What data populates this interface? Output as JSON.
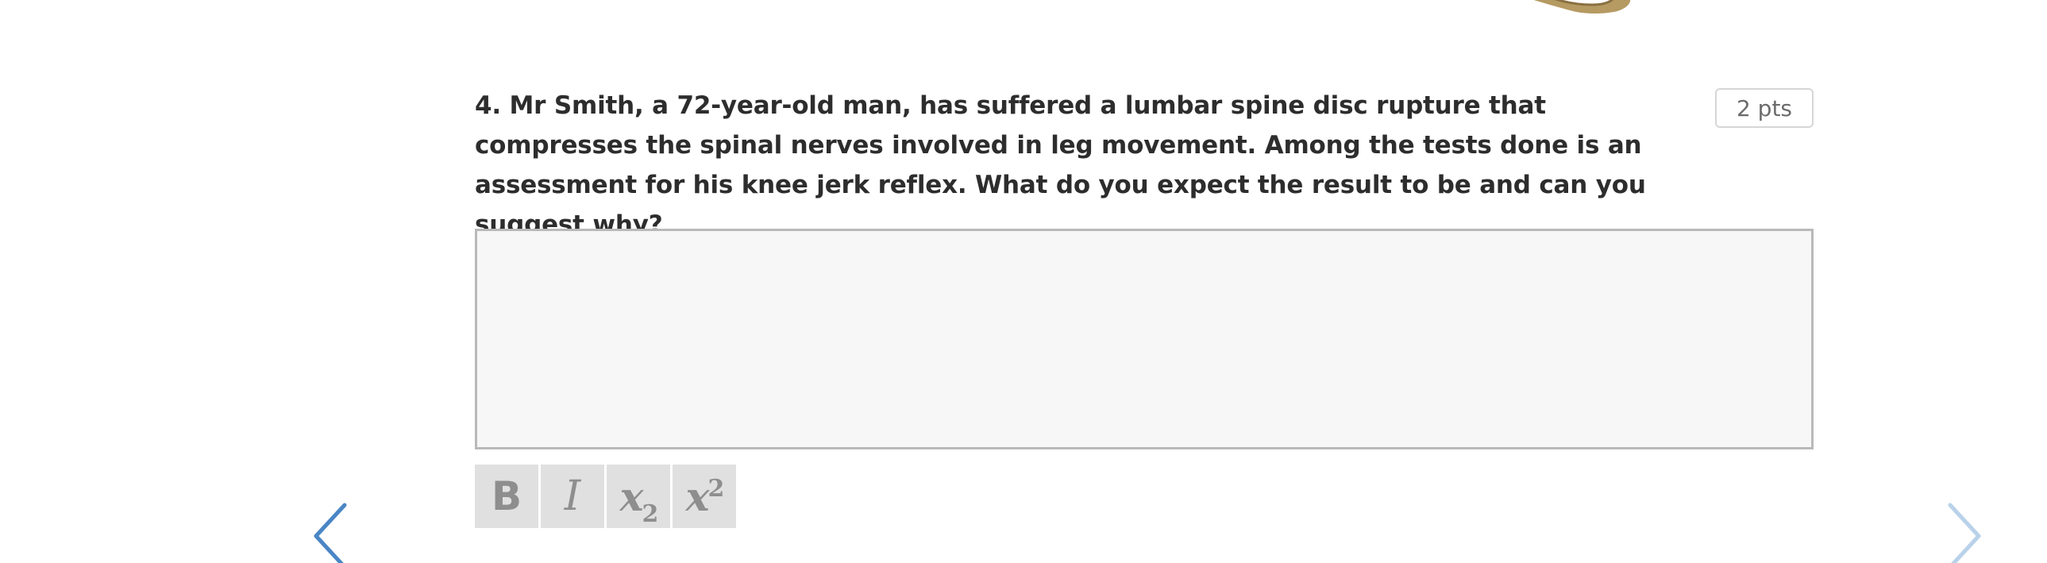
{
  "question": {
    "text": "4. Mr Smith, a 72-year-old man, has suffered a lumbar spine disc rupture that compresses the spinal nerves involved in leg movement. Among the tests done is an assessment for his knee jerk reflex. What do you expect the result to be and can you suggest why?",
    "points": "2 pts"
  },
  "answer": {
    "value": "",
    "placeholder": ""
  },
  "toolbar": {
    "bold_label": "B",
    "italic_label": "I",
    "subscript_base": "x",
    "subscript_index": "2",
    "superscript_base": "x",
    "superscript_index": "2"
  },
  "icons": {
    "previous": "chevron-left-icon",
    "next": "chevron-right-icon"
  },
  "colors": {
    "nav_previous": "#4a86c5",
    "nav_next": "#b9d2ea",
    "text": "#2d2d2d",
    "toolbar_bg": "#e0e0e0",
    "answer_bg": "#f7f7f7"
  }
}
